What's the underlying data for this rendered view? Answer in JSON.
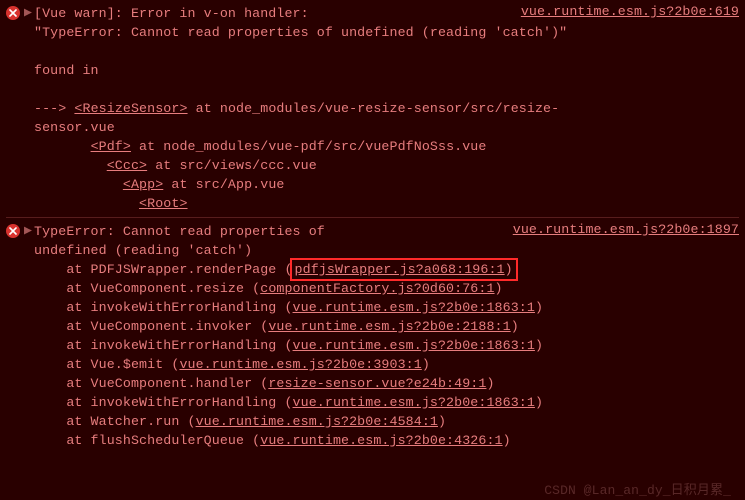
{
  "entries": [
    {
      "source_link": "vue.runtime.esm.js?2b0e:619",
      "warn_prefix": "[Vue warn]: Error in v-on handler: ",
      "warn_msg": "\"TypeError: Cannot read properties of undefined (reading 'catch')\"",
      "found_in": "found in",
      "arrow": "--->",
      "tree_resize_tag": "<ResizeSensor>",
      "tree_resize_at": " at node_modules/vue-resize-sensor/src/resize-",
      "tree_resize_file": "sensor.vue",
      "tree_pdf_tag": "<Pdf>",
      "tree_pdf_at": " at node_modules/vue-pdf/src/vuePdfNoSss.vue",
      "tree_ccc_tag": "<Ccc>",
      "tree_ccc_at": " at src/views/ccc.vue",
      "tree_app_tag": "<App>",
      "tree_app_at": " at src/App.vue",
      "tree_root_tag": "<Root>"
    },
    {
      "source_link": "vue.runtime.esm.js?2b0e:1897",
      "err_line1": "TypeError: Cannot read properties of ",
      "err_line2": "undefined (reading 'catch')",
      "stack": [
        {
          "text": "    at PDFJSWrapper.renderPage (",
          "link": "pdfjsWrapper.js?a068:196:1",
          "close": ")",
          "highlight": true
        },
        {
          "text": "    at VueComponent.resize (",
          "link": "componentFactory.js?0d60:76:1",
          "close": ")"
        },
        {
          "text": "    at invokeWithErrorHandling (",
          "link": "vue.runtime.esm.js?2b0e:1863:1",
          "close": ")"
        },
        {
          "text": "    at VueComponent.invoker (",
          "link": "vue.runtime.esm.js?2b0e:2188:1",
          "close": ")"
        },
        {
          "text": "    at invokeWithErrorHandling (",
          "link": "vue.runtime.esm.js?2b0e:1863:1",
          "close": ")"
        },
        {
          "text": "    at Vue.$emit (",
          "link": "vue.runtime.esm.js?2b0e:3903:1",
          "close": ")"
        },
        {
          "text": "    at VueComponent.handler (",
          "link": "resize-sensor.vue?e24b:49:1",
          "close": ")"
        },
        {
          "text": "    at invokeWithErrorHandling (",
          "link": "vue.runtime.esm.js?2b0e:1863:1",
          "close": ")"
        },
        {
          "text": "    at Watcher.run (",
          "link": "vue.runtime.esm.js?2b0e:4584:1",
          "close": ")"
        },
        {
          "text": "    at flushSchedulerQueue (",
          "link": "vue.runtime.esm.js?2b0e:4326:1",
          "close": ")"
        }
      ]
    }
  ],
  "watermark": "CSDN @Lan_an_dy_日积月累_"
}
